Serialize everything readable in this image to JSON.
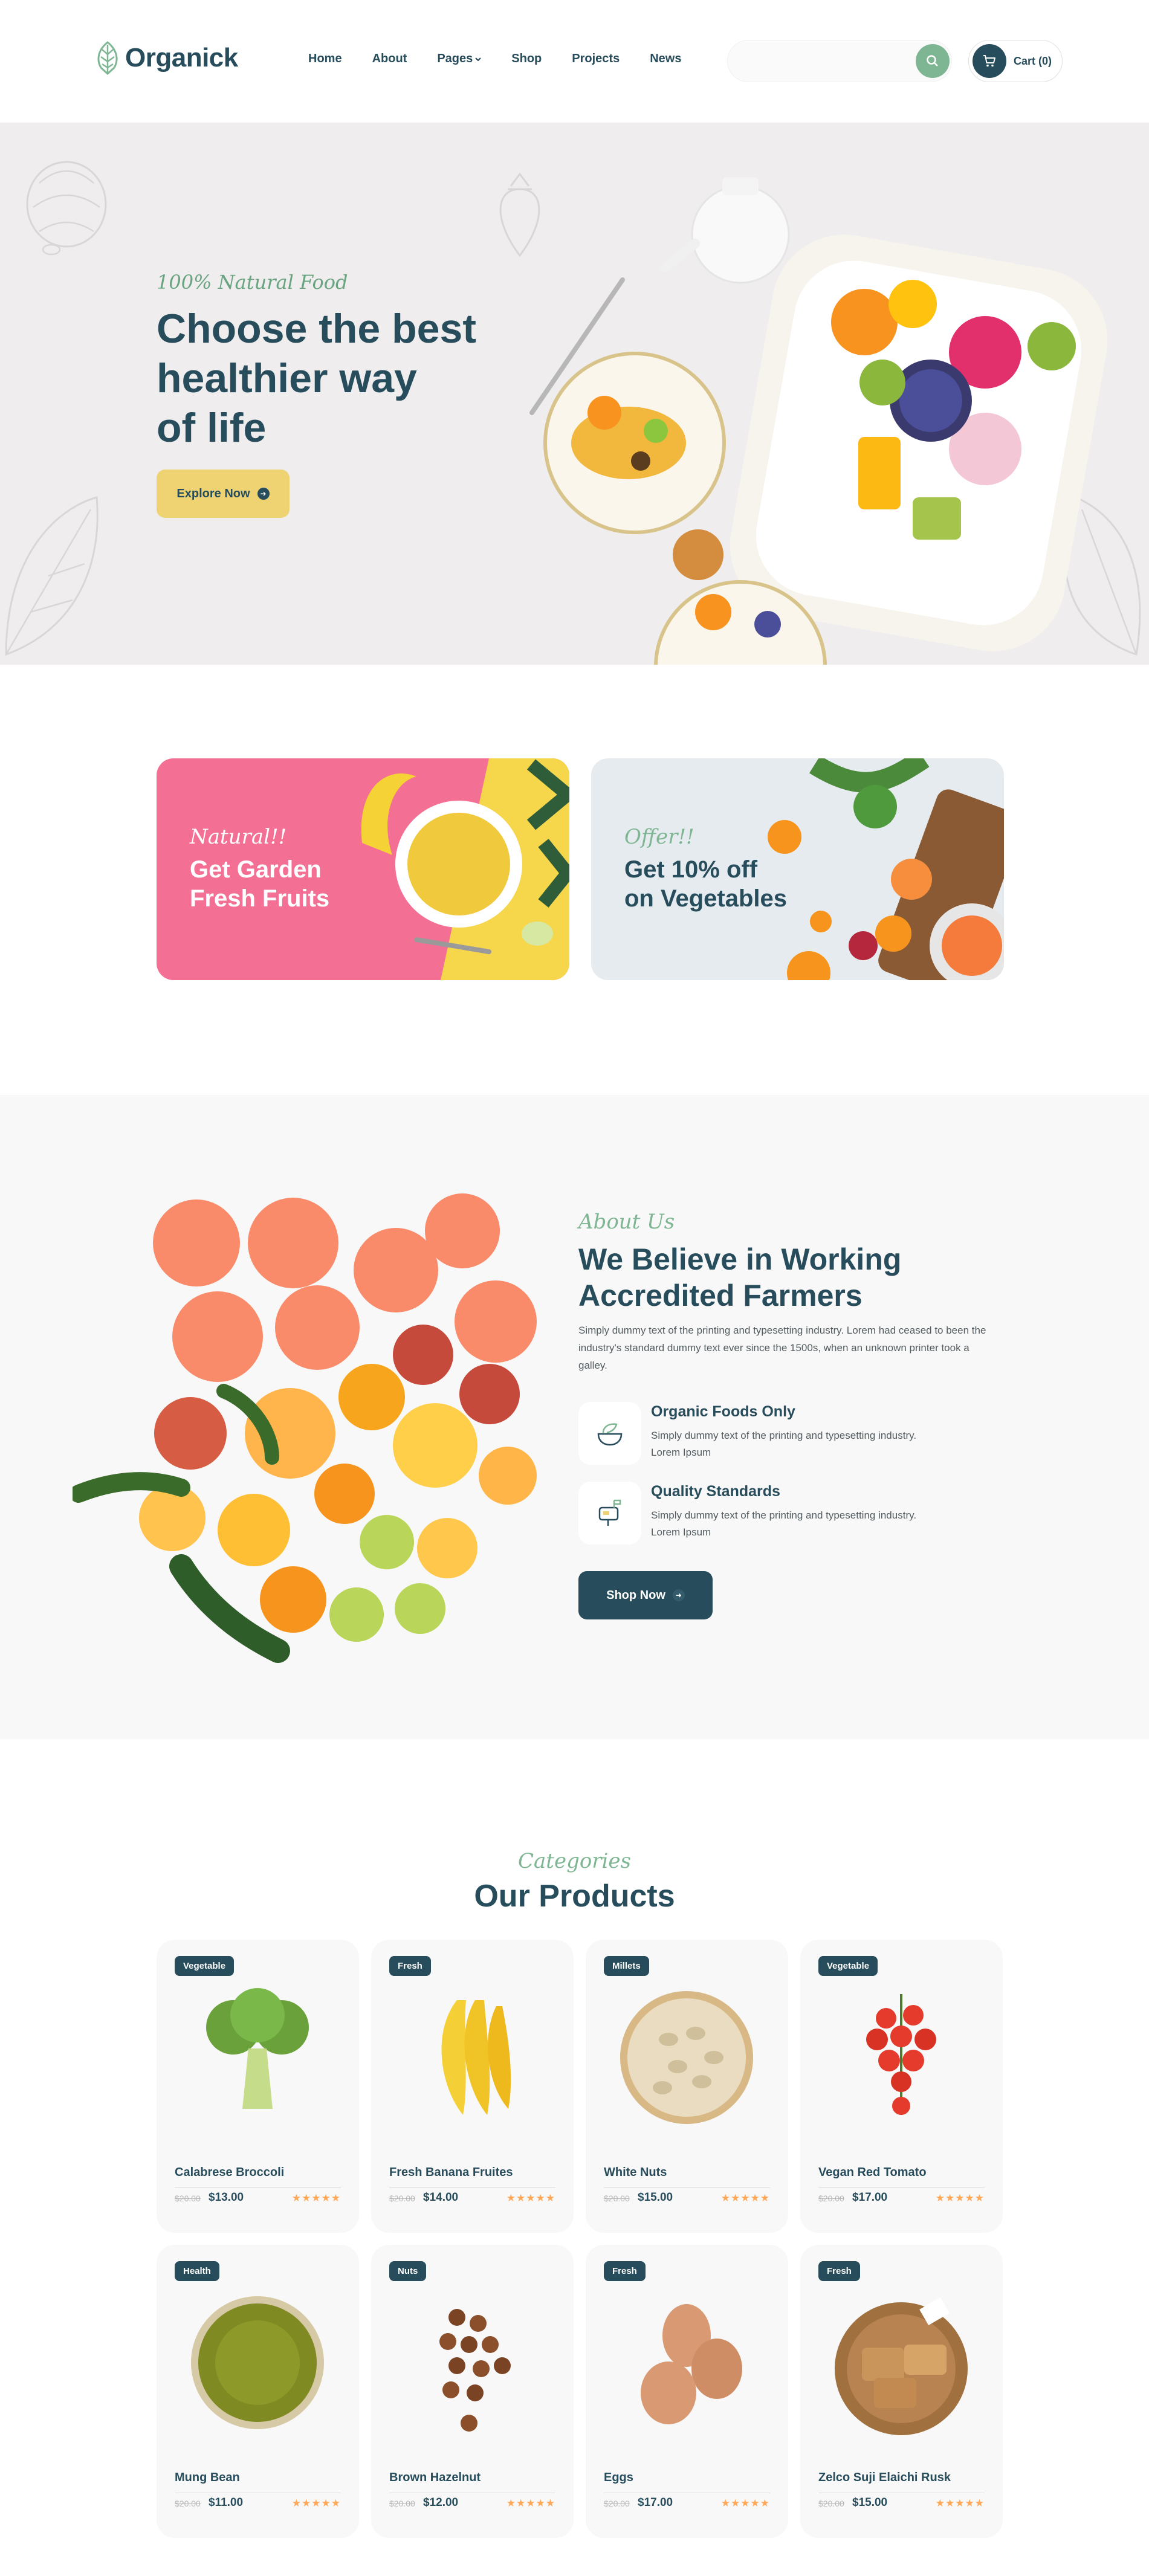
{
  "header": {
    "logo": "Organick",
    "nav": [
      {
        "label": "Home"
      },
      {
        "label": "About"
      },
      {
        "label": "Pages"
      },
      {
        "label": "Shop"
      },
      {
        "label": "Projects"
      },
      {
        "label": "News"
      }
    ],
    "search_placeholder": "",
    "cart_label": "Cart (0)"
  },
  "hero": {
    "subtitle": "100% Natural Food",
    "title_line1": "Choose the best",
    "title_line2": "healthier way",
    "title_line3": "of life",
    "button": "Explore Now"
  },
  "offers": [
    {
      "subtitle": "Natural!!",
      "title_line1": "Get Garden",
      "title_line2": "Fresh Fruits"
    },
    {
      "subtitle": "Offer!!",
      "title_line1": "Get 10% off",
      "title_line2": "on Vegetables"
    }
  ],
  "about": {
    "subtitle": "About Us",
    "title_line1": "We Believe in Working",
    "title_line2": "Accredited Farmers",
    "description": "Simply dummy text of the printing and typesetting industry. Lorem had ceased to been the industry's standard dummy text ever since the 1500s, when an unknown printer took a galley.",
    "features": [
      {
        "title": "Organic Foods Only",
        "description": "Simply dummy text of the printing and typesetting industry. Lorem Ipsum"
      },
      {
        "title": "Quality Standards",
        "description": "Simply dummy text of the printing and typesetting industry. Lorem Ipsum"
      }
    ],
    "button": "Shop Now"
  },
  "products": {
    "subtitle": "Categories",
    "title": "Our Products",
    "items": [
      {
        "badge": "Vegetable",
        "name": "Calabrese Broccoli",
        "old_price": "$20.00",
        "price": "$13.00",
        "stars": "★★★★★"
      },
      {
        "badge": "Fresh",
        "name": "Fresh Banana Fruites",
        "old_price": "$20.00",
        "price": "$14.00",
        "stars": "★★★★★"
      },
      {
        "badge": "Millets",
        "name": "White Nuts",
        "old_price": "$20.00",
        "price": "$15.00",
        "stars": "★★★★★"
      },
      {
        "badge": "Vegetable",
        "name": "Vegan Red Tomato",
        "old_price": "$20.00",
        "price": "$17.00",
        "stars": "★★★★★"
      },
      {
        "badge": "Health",
        "name": "Mung Bean",
        "old_price": "$20.00",
        "price": "$11.00",
        "stars": "★★★★★"
      },
      {
        "badge": "Nuts",
        "name": "Brown Hazelnut",
        "old_price": "$20.00",
        "price": "$12.00",
        "stars": "★★★★★"
      },
      {
        "badge": "Fresh",
        "name": "Eggs",
        "old_price": "$20.00",
        "price": "$17.00",
        "stars": "★★★★★"
      },
      {
        "badge": "Fresh",
        "name": "Zelco Suji Elaichi Rusk",
        "old_price": "$20.00",
        "price": "$15.00",
        "stars": "★★★★★"
      }
    ]
  },
  "colors": {
    "primary": "#274c5b",
    "accent_green": "#7eb693",
    "accent_yellow": "#efd372",
    "accent_pink": "#f36f93",
    "star": "#ffa858"
  },
  "icons": [
    "leaf-logo-icon",
    "search-icon",
    "cart-icon",
    "chevron-down-icon",
    "arrow-right-icon",
    "bowl-icon",
    "mailbox-icon"
  ]
}
